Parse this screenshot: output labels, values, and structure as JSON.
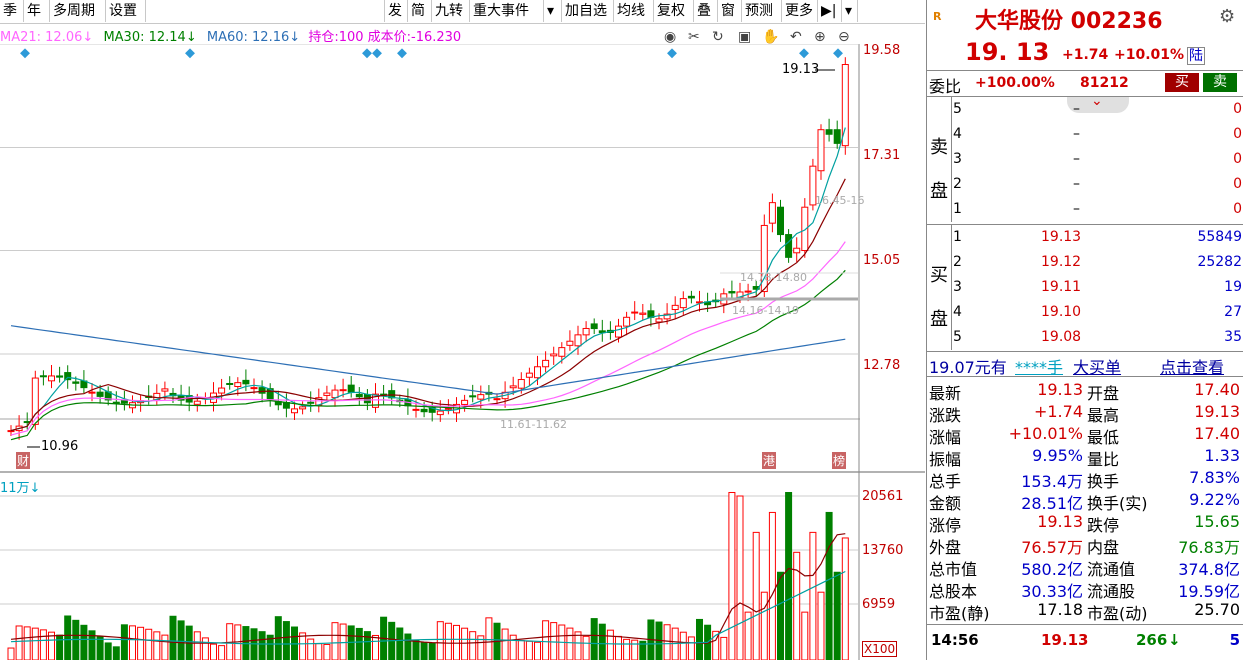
{
  "toolbar": {
    "left": [
      "季",
      "年",
      "多周期",
      "设置"
    ],
    "right": [
      "发",
      "简",
      "九转",
      "重大事件",
      "▾",
      "加自选",
      "均线",
      "复权",
      "叠",
      "窗",
      "预测",
      "更多",
      "▶|",
      "▾"
    ]
  },
  "ma_legend": {
    "ma21": "MA21: 12.06",
    "ma21_arrow": "↓",
    "ma30": "MA30: 12.14",
    "ma30_arrow": "↓",
    "ma60": "MA60: 12.16",
    "ma60_arrow": "↓",
    "position": "持仓:100 成本价:-16.230"
  },
  "price_axis": [
    "19.58",
    "17.31",
    "15.05",
    "12.78"
  ],
  "volume_axis": [
    "20561",
    "13760",
    "6959"
  ],
  "volume_unit": "X100",
  "volume_legend": "11万↓",
  "chart_labels": {
    "high_label": "19.13",
    "low_label": "10.96",
    "range1": "16.45-16",
    "range2": "14.78-14.80",
    "range3": "14.16-14.19",
    "range4": "11.61-11.62",
    "marker_left": "财",
    "marker_mid": "港",
    "marker_right": "榜"
  },
  "colors": {
    "up": "#ff0000",
    "down": "#008000",
    "ma_a": "#00a0a0",
    "ma_b": "#8b0000",
    "ma_c": "#ff66ff",
    "ma_d": "#008000",
    "ma_e": "#2d6fb5"
  },
  "chart_data": {
    "type": "candlestick",
    "ylim": [
      10.5,
      19.9
    ],
    "closes_recent": [
      14.2,
      15.6,
      16.1,
      15.4,
      14.9,
      15.1,
      16.0,
      16.9,
      17.7,
      17.6,
      17.4,
      19.13
    ],
    "last_close": 19.13
  },
  "quote": {
    "name": "大华股份 002236",
    "price": "19. 13",
    "change": "+1.74",
    "change_pct": "+10.01%",
    "tag": "陆",
    "weibi_label": "委比",
    "weibi": "+100.00%",
    "weicha": "81212",
    "buy_btn": "买",
    "sell_btn": "卖"
  },
  "order_book": {
    "sell_label": "卖盘",
    "buy_label": "买盘",
    "sell": [
      {
        "level": "5",
        "price": "–",
        "vol": "0"
      },
      {
        "level": "4",
        "price": "–",
        "vol": "0"
      },
      {
        "level": "3",
        "price": "–",
        "vol": "0"
      },
      {
        "level": "2",
        "price": "–",
        "vol": "0"
      },
      {
        "level": "1",
        "price": "–",
        "vol": "0"
      }
    ],
    "buy": [
      {
        "level": "1",
        "price": "19.13",
        "vol": "55849"
      },
      {
        "level": "2",
        "price": "19.12",
        "vol": "25282"
      },
      {
        "level": "3",
        "price": "19.11",
        "vol": "19"
      },
      {
        "level": "4",
        "price": "19.10",
        "vol": "27"
      },
      {
        "level": "5",
        "price": "19.08",
        "vol": "35"
      }
    ]
  },
  "big_order": {
    "text1": "19.07元有",
    "text2": "****手",
    "text3": "大买单",
    "text4": "点击查看"
  },
  "stats": [
    {
      "k1": "最新",
      "v1": "19.13",
      "k2": "开盘",
      "v2": "17.40"
    },
    {
      "k1": "涨跌",
      "v1": "+1.74",
      "k2": "最高",
      "v2": "19.13"
    },
    {
      "k1": "涨幅",
      "v1": "+10.01%",
      "k2": "最低",
      "v2": "17.40"
    },
    {
      "k1": "振幅",
      "v1": "9.95%",
      "k2": "量比",
      "v2": "1.33"
    },
    {
      "k1": "总手",
      "v1": "153.4万",
      "k2": "换手",
      "v2": "7.83%"
    },
    {
      "k1": "金额",
      "v1": "28.51亿",
      "k2": "换手(实)",
      "v2": "9.22%"
    },
    {
      "k1": "涨停",
      "v1": "19.13",
      "k2": "跌停",
      "v2": "15.65"
    },
    {
      "k1": "外盘",
      "v1": "76.57万",
      "k2": "内盘",
      "v2": "76.83万"
    },
    {
      "k1": "总市值",
      "v1": "580.2亿",
      "k2": "流通值",
      "v2": "374.8亿"
    },
    {
      "k1": "总股本",
      "v1": "30.33亿",
      "k2": "流通股",
      "v2": "19.59亿"
    },
    {
      "k1": "市盈(静)",
      "v1": "17.18",
      "k2": "市盈(动)",
      "v2": "25.70"
    }
  ],
  "tick": {
    "time": "14:56",
    "price": "19.13",
    "vol": "266",
    "arrow": "↓",
    "count": "5"
  }
}
